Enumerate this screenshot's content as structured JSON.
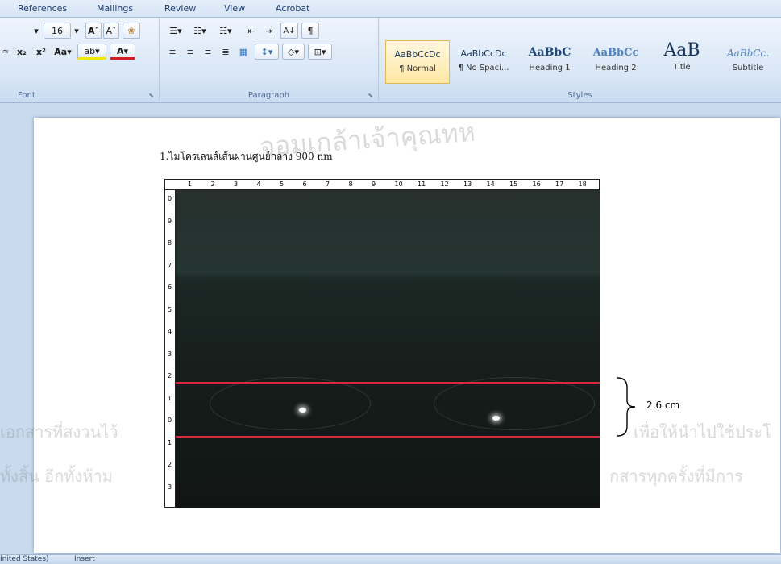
{
  "ribbon": {
    "tabs": [
      "References",
      "Mailings",
      "Review",
      "View",
      "Acrobat"
    ],
    "groups": {
      "font": "Font",
      "paragraph": "Paragraph",
      "styles": "Styles"
    },
    "font": {
      "size": "16",
      "grow": "Aˆ",
      "shrink": "Aˇ",
      "clear": "❀",
      "subscript": "x₂",
      "superscript": "x²",
      "change_case": "Aa",
      "highlight": "ab",
      "color": "A"
    },
    "paragraph": {
      "pilcrow": "¶",
      "sort": "A↓"
    },
    "styles": [
      {
        "preview": "AaBbCcDc",
        "name": "¶ Normal"
      },
      {
        "preview": "AaBbCcDc",
        "name": "¶ No Spaci..."
      },
      {
        "preview": "AaBbC",
        "name": "Heading 1"
      },
      {
        "preview": "AaBbCc",
        "name": "Heading 2"
      },
      {
        "preview": "AaB",
        "name": "Title"
      },
      {
        "preview": "AaBbCc.",
        "name": "Subtitle"
      }
    ]
  },
  "document": {
    "caption": "1.ไมโครเลนส์เส้นผ่านศูนย์กลาง 900 nm",
    "measurement": "2.6 cm",
    "ruler_h": [
      "1",
      "2",
      "3",
      "4",
      "5",
      "6",
      "7",
      "8",
      "9",
      "10",
      "11",
      "12",
      "13",
      "14",
      "15",
      "16",
      "17",
      "18"
    ],
    "ruler_v": [
      "0",
      "9",
      "8",
      "7",
      "6",
      "5",
      "4",
      "3",
      "2",
      "1",
      "0",
      "1",
      "2",
      "3"
    ]
  },
  "watermark": {
    "line1": "เอกสารที่สงวนไว้",
    "line1b": "เพื่อให้นำไปใช้ประโ",
    "line2": "ทั้งสิ้น อีกทั้งห้าม",
    "line2b": "กสารทุกครั้งที่มีการ",
    "seal": "จอมเกล้าเจ้าคุณทห"
  },
  "statusbar": {
    "language": "Inited States)",
    "mode": "Insert"
  },
  "colors": {
    "red_line": "#d72b3a",
    "ribbon": "#d8e6f6",
    "selected_style": "#ffe7a3"
  }
}
